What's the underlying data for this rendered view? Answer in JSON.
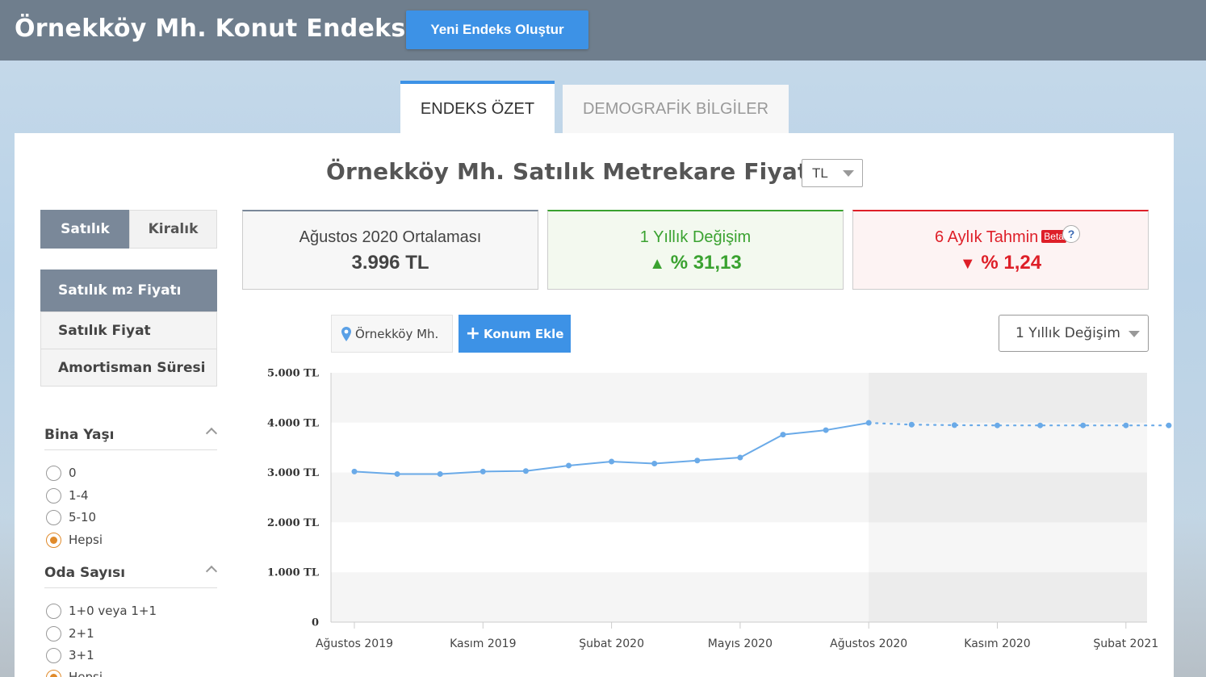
{
  "header": {
    "title": "Örnekköy Mh. Konut Endeksi",
    "new_index_label": "Yeni Endeks Oluştur"
  },
  "tabs": [
    {
      "label": "ENDEKS ÖZET",
      "active": true
    },
    {
      "label": "DEMOGRAFİK BİLGİLER",
      "active": false
    }
  ],
  "main": {
    "title": "Örnekköy Mh. Satılık Metrekare Fiyatı",
    "currency": "TL"
  },
  "sidebar": {
    "segments": [
      {
        "label": "Satılık",
        "active": true
      },
      {
        "label": "Kiralık",
        "active": false
      }
    ],
    "menu": [
      {
        "label": "Satılık m",
        "sup": "2",
        "label_suffix": " Fiyatı",
        "active": true
      },
      {
        "label": "Satılık Fiyat",
        "active": false
      },
      {
        "label": "Amortisman Süresi",
        "active": false
      }
    ],
    "filters": [
      {
        "title": "Bina Yaşı",
        "options": [
          "0",
          "1-4",
          "5-10",
          "Hepsi"
        ],
        "selected": "Hepsi"
      },
      {
        "title": "Oda Sayısı",
        "options": [
          "1+0 veya 1+1",
          "2+1",
          "3+1",
          "Hepsi"
        ],
        "selected": "Hepsi"
      }
    ]
  },
  "stats": {
    "average": {
      "label": "Ağustos 2020 Ortalaması",
      "value": "3.996 TL"
    },
    "change": {
      "label": "1 Yıllık Değişim",
      "arrow": "▲",
      "value": "% 31,13"
    },
    "forecast": {
      "label": "6 Aylık Tahmin",
      "badge": "Beta",
      "help": "?",
      "arrow": "▼",
      "value": "% 1,24"
    }
  },
  "controls": {
    "location": "Örnekköy Mh.",
    "add_location": "Konum Ekle",
    "range": "1 Yıllık Değişim"
  },
  "colors": {
    "accent": "#3d92e6",
    "up": "#3aa230",
    "down": "#de1f28",
    "line": "#6aaae8"
  },
  "chart_data": {
    "type": "line",
    "y_ticks": [
      "5.000 TL",
      "4.000 TL",
      "3.000 TL",
      "2.000 TL",
      "1.000 TL",
      "0"
    ],
    "ylim": [
      0,
      5000
    ],
    "x_tick_labels": [
      "Ağustos 2019",
      "Kasım 2019",
      "Şubat 2020",
      "Mayıs 2020",
      "Ağustos 2020",
      "Kasım 2020",
      "Şubat 2021"
    ],
    "x_tick_index": [
      0,
      3,
      6,
      9,
      12,
      15,
      18
    ],
    "series": [
      {
        "style": "solid",
        "values": [
          3020,
          2970,
          2970,
          3020,
          3030,
          3140,
          3220,
          3180,
          3240,
          3300,
          3760,
          3850,
          3996
        ]
      },
      {
        "style": "dotted",
        "start_index": 12,
        "values": [
          3996,
          3960,
          3950,
          3945,
          3945,
          3945,
          3945,
          3945
        ]
      }
    ],
    "forecast_start_index": 12
  }
}
